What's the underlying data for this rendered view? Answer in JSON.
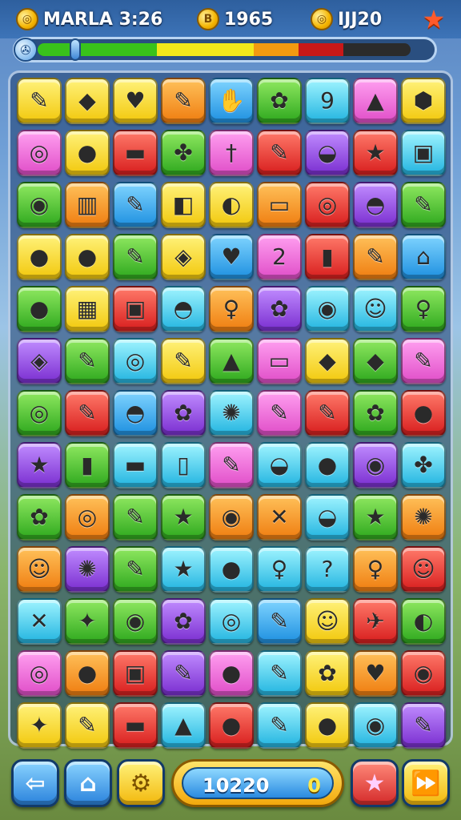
{
  "hud": {
    "player_name": "MARLA 3:26",
    "coins": "1965",
    "lives": "IJJ20",
    "coin_glyph": "◎",
    "coins_glyph": "B",
    "lives_glyph": "◎",
    "star_icon": "star-icon",
    "star_glyph": "★"
  },
  "progress": {
    "level_fraction": 0.12,
    "icon_glyph": "✇",
    "segments": [
      {
        "color": "#39c21b",
        "fraction": 0.32
      },
      {
        "color": "#f2e81a",
        "fraction": 0.26
      },
      {
        "color": "#f29a10",
        "fraction": 0.12
      },
      {
        "color": "#c81818",
        "fraction": 0.12
      },
      {
        "color": "#2b2b2b",
        "fraction": 0.18
      }
    ]
  },
  "board": {
    "columns": 9,
    "rows": 13,
    "tiles": [
      [
        "yellow",
        "✎"
      ],
      [
        "yellow",
        "◆"
      ],
      [
        "yellow",
        "♥"
      ],
      [
        "orange",
        "✎"
      ],
      [
        "blue",
        "✋"
      ],
      [
        "green",
        "✿"
      ],
      [
        "cyan",
        "9"
      ],
      [
        "pink",
        "▲"
      ],
      [
        "yellow",
        "⬢"
      ],
      [
        "pink",
        "◎"
      ],
      [
        "yellow",
        "●"
      ],
      [
        "red",
        "▬"
      ],
      [
        "green",
        "✤"
      ],
      [
        "pink",
        "†"
      ],
      [
        "red",
        "✎"
      ],
      [
        "purple",
        "◒"
      ],
      [
        "red",
        "★"
      ],
      [
        "cyan",
        "▣"
      ],
      [
        "green",
        "◉"
      ],
      [
        "orange",
        "▥"
      ],
      [
        "blue",
        "✎"
      ],
      [
        "yellow",
        "◧"
      ],
      [
        "yellow",
        "◐"
      ],
      [
        "orange",
        "▭"
      ],
      [
        "red",
        "◎"
      ],
      [
        "purple",
        "◓"
      ],
      [
        "green",
        "✎"
      ],
      [
        "yellow",
        "●"
      ],
      [
        "yellow",
        "●"
      ],
      [
        "green",
        "✎"
      ],
      [
        "yellow",
        "◈"
      ],
      [
        "blue",
        "♥"
      ],
      [
        "pink",
        "2"
      ],
      [
        "red",
        "▮"
      ],
      [
        "orange",
        "✎"
      ],
      [
        "blue",
        "⌂"
      ],
      [
        "green",
        "●"
      ],
      [
        "yellow",
        "▦"
      ],
      [
        "red",
        "▣"
      ],
      [
        "cyan",
        "◓"
      ],
      [
        "orange",
        "♀"
      ],
      [
        "purple",
        "✿"
      ],
      [
        "cyan",
        "◉"
      ],
      [
        "cyan",
        "☺"
      ],
      [
        "green",
        "♀"
      ],
      [
        "purple",
        "◈"
      ],
      [
        "green",
        "✎"
      ],
      [
        "cyan",
        "◎"
      ],
      [
        "yellow",
        "✎"
      ],
      [
        "green",
        "▲"
      ],
      [
        "pink",
        "▭"
      ],
      [
        "yellow",
        "◆"
      ],
      [
        "green",
        "◆"
      ],
      [
        "pink",
        "✎"
      ],
      [
        "green",
        "◎"
      ],
      [
        "red",
        "✎"
      ],
      [
        "blue",
        "◓"
      ],
      [
        "purple",
        "✿"
      ],
      [
        "cyan",
        "✺"
      ],
      [
        "pink",
        "✎"
      ],
      [
        "red",
        "✎"
      ],
      [
        "green",
        "✿"
      ],
      [
        "red",
        "●"
      ],
      [
        "purple",
        "★"
      ],
      [
        "green",
        "▮"
      ],
      [
        "cyan",
        "▬"
      ],
      [
        "cyan",
        "▯"
      ],
      [
        "pink",
        "✎"
      ],
      [
        "cyan",
        "◒"
      ],
      [
        "cyan",
        "●"
      ],
      [
        "purple",
        "◉"
      ],
      [
        "cyan",
        "✤"
      ],
      [
        "green",
        "✿"
      ],
      [
        "orange",
        "◎"
      ],
      [
        "green",
        "✎"
      ],
      [
        "green",
        "★"
      ],
      [
        "orange",
        "◉"
      ],
      [
        "orange",
        "✕"
      ],
      [
        "cyan",
        "◒"
      ],
      [
        "green",
        "★"
      ],
      [
        "orange",
        "✺"
      ],
      [
        "orange",
        "☺"
      ],
      [
        "purple",
        "✺"
      ],
      [
        "green",
        "✎"
      ],
      [
        "cyan",
        "★"
      ],
      [
        "cyan",
        "●"
      ],
      [
        "cyan",
        "♀"
      ],
      [
        "cyan",
        "?"
      ],
      [
        "orange",
        "♀"
      ],
      [
        "red",
        "☺"
      ],
      [
        "cyan",
        "✕"
      ],
      [
        "green",
        "✦"
      ],
      [
        "green",
        "◉"
      ],
      [
        "purple",
        "✿"
      ],
      [
        "cyan",
        "◎"
      ],
      [
        "blue",
        "✎"
      ],
      [
        "yellow",
        "☺"
      ],
      [
        "red",
        "✈"
      ],
      [
        "green",
        "◐"
      ],
      [
        "pink",
        "◎"
      ],
      [
        "orange",
        "●"
      ],
      [
        "red",
        "▣"
      ],
      [
        "purple",
        "✎"
      ],
      [
        "pink",
        "●"
      ],
      [
        "cyan",
        "✎"
      ],
      [
        "yellow",
        "✿"
      ],
      [
        "orange",
        "♥"
      ],
      [
        "red",
        "◉"
      ],
      [
        "yellow",
        "✦"
      ],
      [
        "yellow",
        "✎"
      ],
      [
        "red",
        "▬"
      ],
      [
        "cyan",
        "▲"
      ],
      [
        "red",
        "●"
      ],
      [
        "cyan",
        "✎"
      ],
      [
        "yellow",
        "●"
      ],
      [
        "cyan",
        "◉"
      ],
      [
        "purple",
        "✎"
      ]
    ]
  },
  "footer": {
    "back_glyph": "⇦",
    "home_glyph": "⌂",
    "settings_glyph": "⚙",
    "score": "10220",
    "score_extra": "0",
    "star_glyph": "★",
    "forward_glyph": "⏩"
  }
}
